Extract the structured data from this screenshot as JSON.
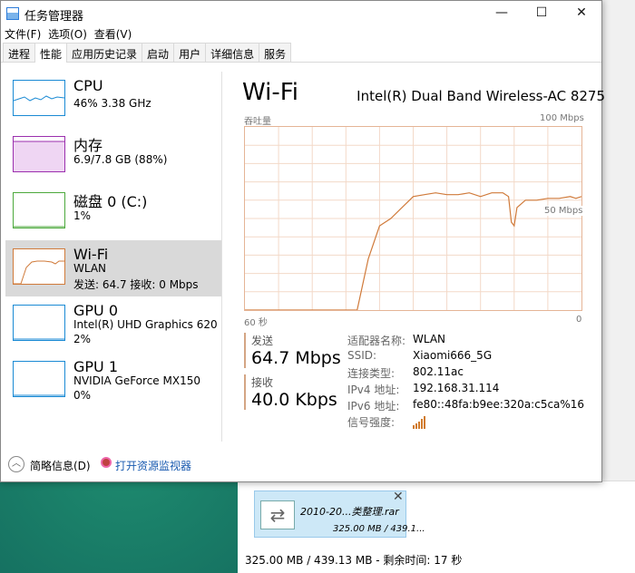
{
  "window": {
    "title": "任务管理器",
    "controls": {
      "minimize": "—",
      "maximize": "☐",
      "close": "✕"
    }
  },
  "menu": [
    "文件(F)",
    "选项(O)",
    "查看(V)"
  ],
  "tabs": [
    "进程",
    "性能",
    "应用历史记录",
    "启动",
    "用户",
    "详细信息",
    "服务"
  ],
  "active_tab": "性能",
  "sidebar": {
    "items": [
      {
        "name": "CPU",
        "line1": "46%  3.38 GHz",
        "line2": "",
        "color": "#1a8ad4"
      },
      {
        "name": "内存",
        "line1": "6.9/7.8 GB (88%)",
        "line2": "",
        "color": "#9b2fae"
      },
      {
        "name": "磁盘 0 (C:)",
        "line1": "1%",
        "line2": "",
        "color": "#4ca93c"
      },
      {
        "name": "Wi-Fi",
        "line1": "WLAN",
        "line2": "发送: 64.7  接收: 0 Mbps",
        "color": "#d07a3a"
      },
      {
        "name": "GPU 0",
        "line1": "Intel(R) UHD Graphics 620",
        "line2": "2%",
        "color": "#1a8ad4"
      },
      {
        "name": "GPU 1",
        "line1": "NVIDIA GeForce MX150",
        "line2": "0%",
        "color": "#1a8ad4"
      }
    ]
  },
  "main": {
    "title": "Wi-Fi",
    "device": "Intel(R) Dual Band Wireless-AC 8275",
    "throughput_label": "吞吐量",
    "max_label": "100 Mbps",
    "mid_label": "50 Mbps",
    "time_label": "60 秒",
    "zero_label": "0",
    "send_label": "发送",
    "send_value": "64.7 Mbps",
    "recv_label": "接收",
    "recv_value": "40.0 Kbps",
    "info": [
      {
        "k": "适配器名称:",
        "v": "WLAN"
      },
      {
        "k": "SSID:",
        "v": "Xiaomi666_5G"
      },
      {
        "k": "连接类型:",
        "v": "802.11ac"
      },
      {
        "k": "IPv4 地址:",
        "v": "192.168.31.114"
      },
      {
        "k": "IPv6 地址:",
        "v": "fe80::48fa:b9ee:320a:c5ca%16"
      },
      {
        "k": "信号强度:",
        "v": ""
      }
    ],
    "signal_bars": 5
  },
  "footer": {
    "collapse_label": "简略信息(D)",
    "monitor_link": "打开资源监视器"
  },
  "copy_dialog": {
    "file_name": "2010-20...类整理.rar",
    "file_size": "325.00 MB / 439.1...",
    "status": "325.00 MB / 439.13 MB - 剩余时间:   17 秒"
  },
  "colors": {
    "wifi_line": "#d07a3a",
    "wifi_grid": "#f3d9c8",
    "wifi_border": "#e5b496"
  },
  "chart_data": {
    "type": "line",
    "title": "",
    "xlabel": "60 秒",
    "ylabel": "吞吐量",
    "xlim": [
      60,
      0
    ],
    "ylim": [
      0,
      100
    ],
    "series": [
      {
        "name": "",
        "x": [
          60,
          59,
          58,
          56,
          55,
          54,
          53,
          52,
          51,
          50,
          49,
          48,
          47,
          46,
          45,
          44,
          43,
          42,
          41,
          40,
          38,
          36,
          34,
          32,
          30,
          28,
          26,
          24,
          22,
          20,
          18,
          16,
          14,
          13,
          12.5,
          12,
          11.5,
          10,
          8,
          6,
          4,
          2,
          1,
          0
        ],
        "y": [
          0,
          0,
          0,
          0,
          0,
          0,
          0,
          0,
          0,
          0,
          0,
          0,
          0,
          0,
          0,
          0,
          0,
          0,
          0,
          0,
          28,
          46,
          50,
          56,
          62,
          63,
          64,
          63,
          63,
          64,
          62,
          64,
          64,
          62,
          48,
          46,
          56,
          60,
          60,
          61,
          61,
          62,
          61,
          62
        ]
      }
    ]
  }
}
